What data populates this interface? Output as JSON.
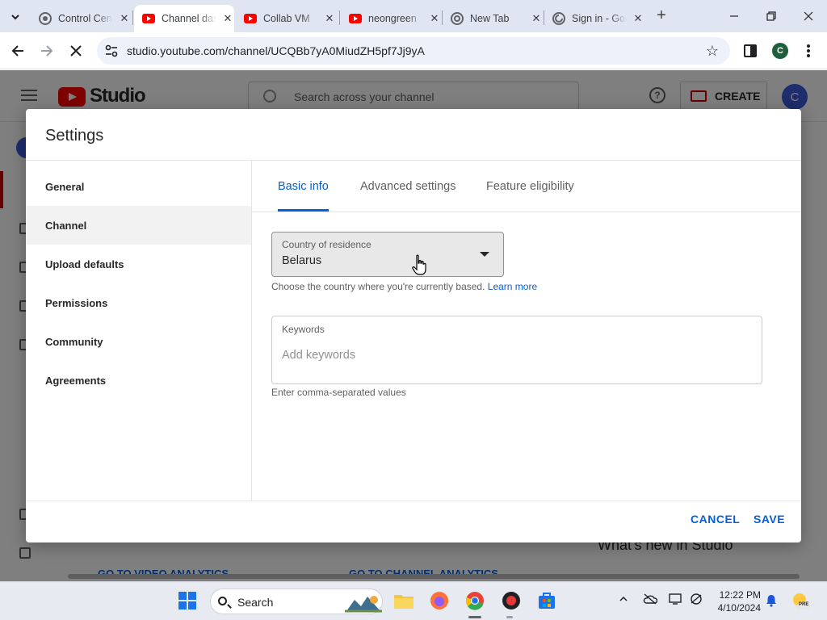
{
  "browser": {
    "tabs": [
      {
        "title": "Control Cen",
        "active": false
      },
      {
        "title": "Channel dashboard",
        "active": true
      },
      {
        "title": "Collab VM",
        "active": false
      },
      {
        "title": "neongreen",
        "active": false
      },
      {
        "title": "New Tab",
        "active": false
      },
      {
        "title": "Sign in - Google",
        "active": false
      }
    ],
    "url": "studio.youtube.com/channel/UCQBb7yA0MiudZH5pf7Jj9yA",
    "profile_initial": "C"
  },
  "studio": {
    "logo_text": "Studio",
    "search_placeholder": "Search across your channel",
    "create_label": "CREATE",
    "avatar_initial": "C",
    "bg_link_video": "GO TO VIDEO ANALYTICS",
    "bg_link_channel": "GO TO CHANNEL ANALYTICS",
    "bg_whats_new": "What's new in Studio"
  },
  "settings": {
    "title": "Settings",
    "nav": [
      "General",
      "Channel",
      "Upload defaults",
      "Permissions",
      "Community",
      "Agreements"
    ],
    "selected_nav": "Channel",
    "tabs": [
      "Basic info",
      "Advanced settings",
      "Feature eligibility"
    ],
    "active_tab": "Basic info",
    "country": {
      "label": "Country of residence",
      "value": "Belarus",
      "help": "Choose the country where you're currently based.",
      "learn_more": "Learn more"
    },
    "keywords": {
      "label": "Keywords",
      "placeholder": "Add keywords",
      "help": "Enter comma-separated values"
    },
    "cancel_label": "CANCEL",
    "save_label": "SAVE"
  },
  "taskbar": {
    "search_label": "Search",
    "time": "12:22 PM",
    "date": "4/10/2024",
    "pre_badge": "PRE"
  },
  "colors": {
    "accent_blue": "#065fd4",
    "youtube_red": "#ff0000",
    "avatar_blue": "#3b5bdb"
  }
}
